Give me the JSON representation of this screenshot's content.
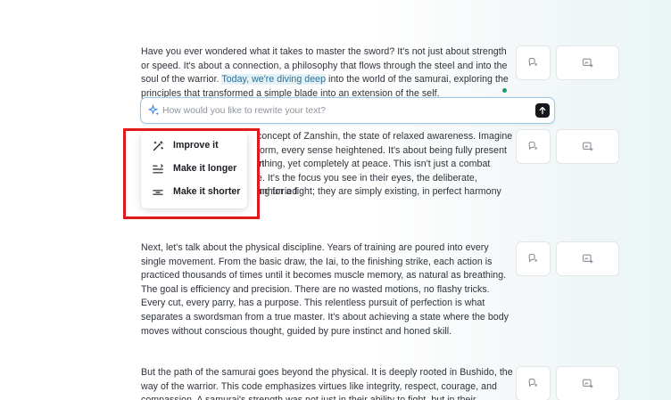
{
  "paragraphs": [
    {
      "before": "Have you ever wondered what it takes to master the sword? It's not just about strength or speed. It's about a connection, a philosophy that flows through the steel and into the soul of the warrior. ",
      "highlight": "Today, we're diving deep",
      "after": " into the world of the samurai, exploring the principles that transformed a simple blade into an extension of the self."
    },
    {
      "lines": [
        "concept of Zanshin, the state of relaxed awareness. Imagine",
        "torm, every sense heightened. It's about being fully present in",
        "ything, yet completely at peace. This isn't just a combat",
        "e. It's the focus you see in their eyes, the deliberate, unhurried",
        "ing for a fight; they are simply existing, in perfect harmony"
      ]
    },
    {
      "text": "Next, let's talk about the physical discipline. Years of training are poured into every single movement. From the basic draw, the Iai, to the finishing strike, each action is practiced thousands of times until it becomes muscle memory, as natural as breathing. The goal is efficiency and precision. There are no wasted motions, no flashy tricks. Every cut, every parry, has a purpose. This relentless pursuit of perfection is what separates a swordsman from a true master. It's about achieving a state where the body moves without conscious thought, guided by pure instinct and honed skill."
    },
    {
      "text": "But the path of the samurai goes beyond the physical. It is deeply rooted in Bushido, the way of the warrior. This code emphasizes virtues like integrity, respect, courage, and compassion. A samurai's strength was not just in their ability to fight, but in their"
    }
  ],
  "prompt": {
    "placeholder": "How would you like to rewrite your text?",
    "value": ""
  },
  "rewrite_menu": {
    "items": [
      {
        "label": "Improve it",
        "icon": "magic-wand-icon"
      },
      {
        "label": "Make it longer",
        "icon": "lengthen-lines-icon"
      },
      {
        "label": "Make it shorter",
        "icon": "shorten-lines-icon"
      }
    ]
  },
  "side_actions": {
    "left_icon": "quote-bubble-icon",
    "right_icon": "image-add-icon"
  },
  "colors": {
    "highlight_bg": "#e4f1f7",
    "highlight_text": "#2d6f98",
    "annotation_red": "#e0191b",
    "status_dot": "#1a9a6c",
    "send_button": "#15171a"
  }
}
